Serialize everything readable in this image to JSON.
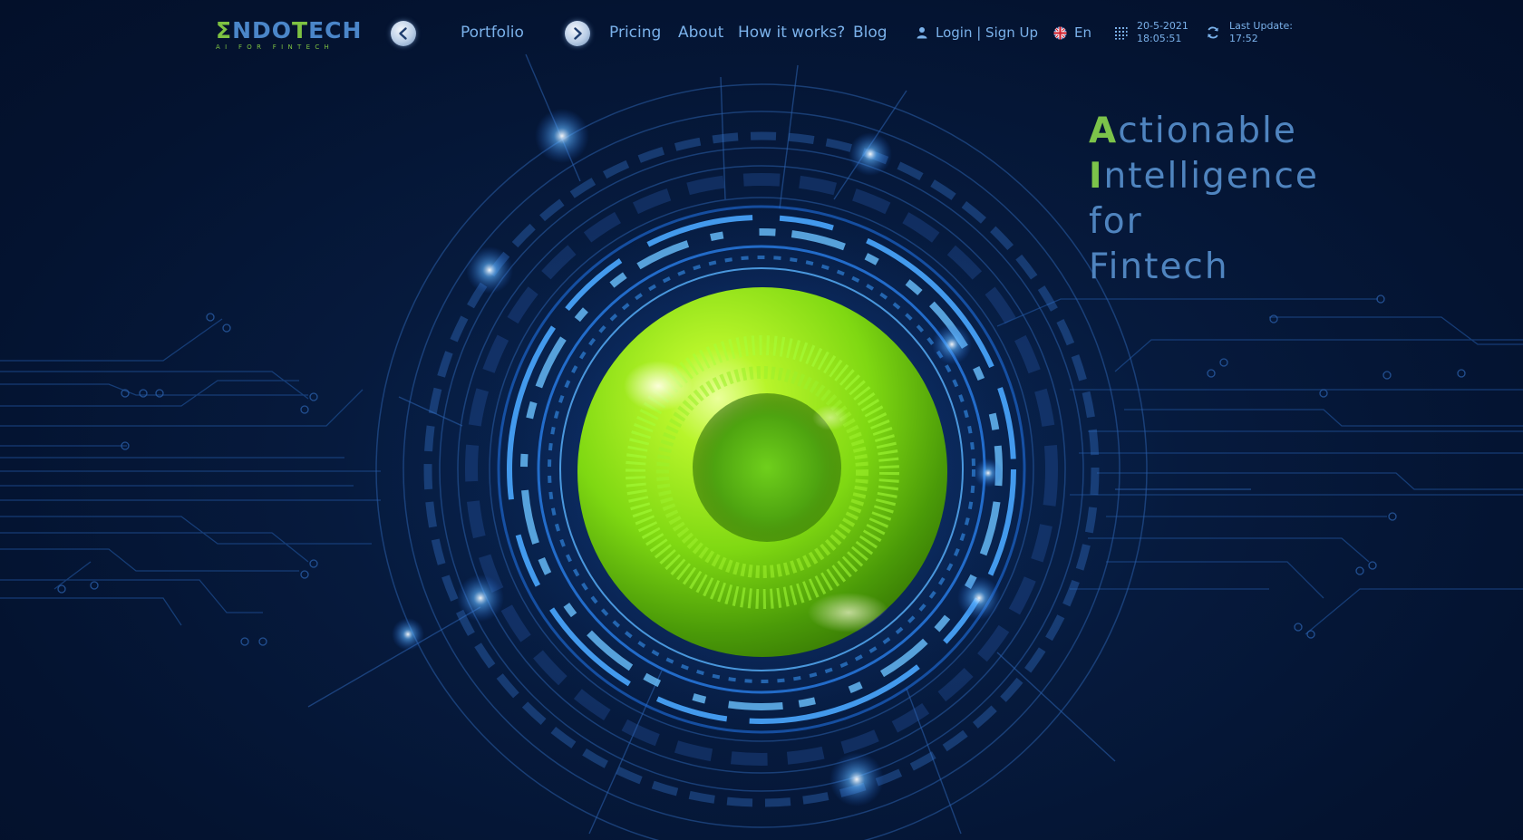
{
  "brand": {
    "logo_prefix": "Σ",
    "logo_ndo": "NDO",
    "logo_t": "T",
    "logo_ech": "ECH",
    "logo_sub": "AI FOR FINTECH"
  },
  "nav": {
    "items": [
      "Portfolio",
      "Pricing",
      "About",
      "How it works?",
      "Blog"
    ],
    "prev_icon": "chevron-left-icon",
    "next_icon": "chevron-right-icon"
  },
  "header": {
    "login_label": "Login | Sign Up",
    "language": "En",
    "date": "20-5-2021",
    "time": "18:05:51",
    "last_update_label": "Last Update:",
    "last_update_time": "17:52"
  },
  "hero": {
    "lines": [
      {
        "cap": "A",
        "rest": "ctionable"
      },
      {
        "cap": "I",
        "rest": "ntelligence"
      },
      {
        "cap": "",
        "rest": "for"
      },
      {
        "cap": "",
        "rest": "Fintech"
      }
    ]
  },
  "colors": {
    "background": "#051633",
    "accent_blue": "#7ab1ea",
    "accent_green": "#7cc34a",
    "orb_green": "#8fe01a",
    "ring_blue": "#3a9cff"
  }
}
